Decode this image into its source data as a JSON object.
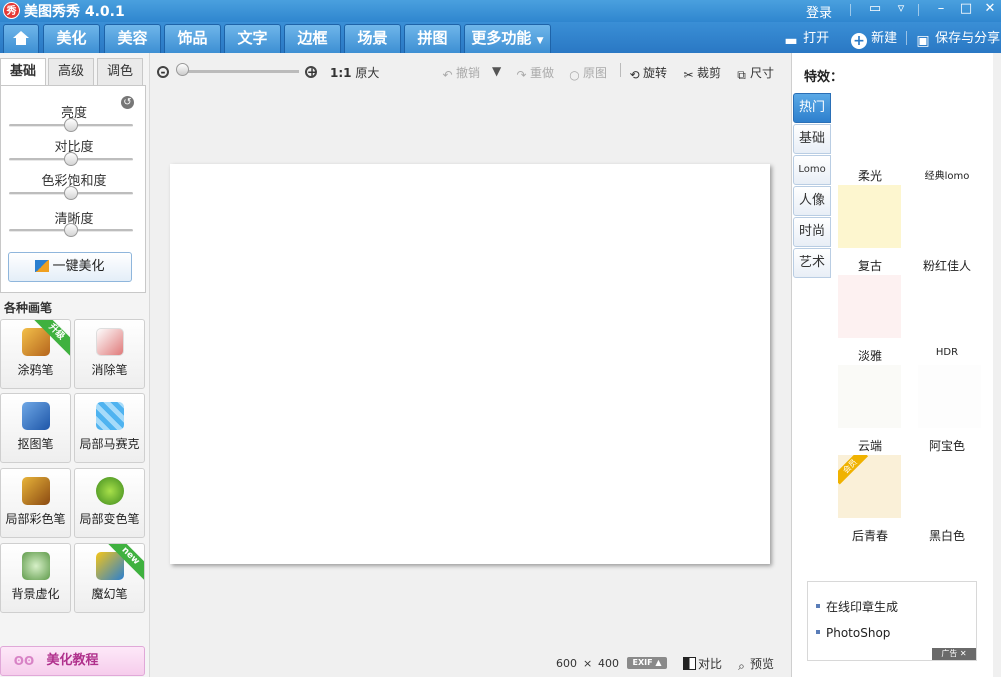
{
  "titlebar": {
    "logo_char": "秀",
    "title": "美图秀秀 4.0.1",
    "login": "登录"
  },
  "nav": {
    "tabs": [
      {
        "label": "美化",
        "active": true
      },
      {
        "label": "美容",
        "active": false
      },
      {
        "label": "饰品",
        "active": false
      },
      {
        "label": "文字",
        "active": false
      },
      {
        "label": "边框",
        "active": false
      },
      {
        "label": "场景",
        "active": false
      },
      {
        "label": "拼图",
        "active": false
      }
    ],
    "more": "更多功能",
    "open": "打开",
    "new": "新建",
    "save_share": "保存与分享"
  },
  "left": {
    "tabs": [
      "基础",
      "高级",
      "调色"
    ],
    "sliders": [
      {
        "label": "亮度",
        "value": 0.5
      },
      {
        "label": "对比度",
        "value": 0.5
      },
      {
        "label": "色彩饱和度",
        "value": 0.5
      },
      {
        "label": "清晰度",
        "value": 0.5
      }
    ],
    "one_key": "一键美化",
    "pens_title": "各种画笔",
    "pens": [
      {
        "label": "涂鸦笔",
        "badge": "升级"
      },
      {
        "label": "消除笔",
        "badge": ""
      },
      {
        "label": "抠图笔",
        "badge": ""
      },
      {
        "label": "局部马赛克",
        "badge": ""
      },
      {
        "label": "局部彩色笔",
        "badge": ""
      },
      {
        "label": "局部变色笔",
        "badge": ""
      },
      {
        "label": "背景虚化",
        "badge": ""
      },
      {
        "label": "魔幻笔",
        "badge": "new"
      }
    ],
    "tutorial": "美化教程"
  },
  "toolbar": {
    "ratio": "1:1",
    "original_size": "原大",
    "undo": "撤销",
    "redo": "重做",
    "original": "原图",
    "rotate": "旋转",
    "crop": "裁剪",
    "resize": "尺寸"
  },
  "status": {
    "width": "600",
    "times": "×",
    "height": "400",
    "exif": "EXIF",
    "compare": "对比",
    "preview": "预览"
  },
  "effects": {
    "title": "特效：",
    "tabs": [
      "热门",
      "基础",
      "Lomo",
      "人像",
      "时尚",
      "艺术"
    ],
    "items": [
      "柔光",
      "经典lomo",
      "复古",
      "粉红佳人",
      "淡雅",
      "HDR",
      "云端",
      "阿宝色",
      "后青春",
      "黑白色"
    ],
    "vip_badge": "会员"
  },
  "ad": {
    "items": [
      "在线印章生成",
      "PhotoShop"
    ],
    "tag": "广告"
  }
}
